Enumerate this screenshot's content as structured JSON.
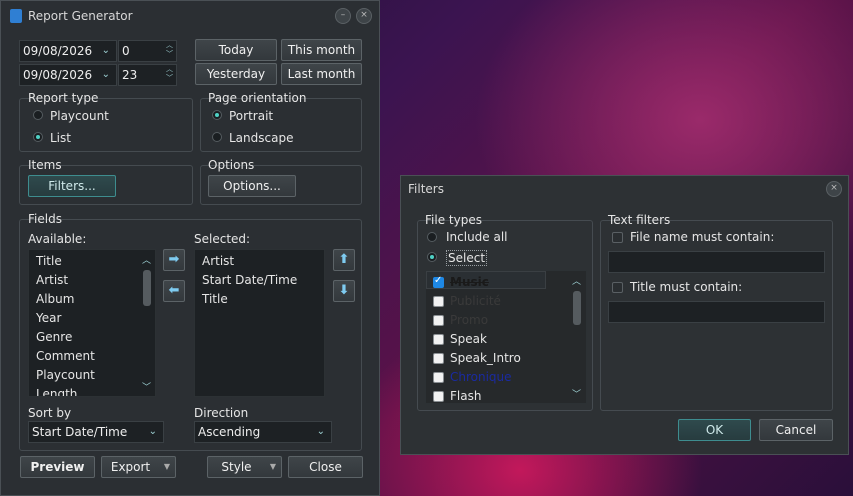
{
  "report_window": {
    "title": "Report Generator",
    "date_from": "09/08/2026",
    "hour_from": "0",
    "date_to": "09/08/2026",
    "hour_to": "23",
    "today_label": "Today",
    "this_month_label": "This month",
    "yesterday_label": "Yesterday",
    "last_month_label": "Last month",
    "report_type": {
      "label": "Report type",
      "options": [
        "Playcount",
        "List"
      ],
      "selected": "List"
    },
    "page_orientation": {
      "label": "Page orientation",
      "options": [
        "Portrait",
        "Landscape"
      ],
      "selected": "Portrait"
    },
    "items": {
      "label": "Items",
      "filters_button": "Filters..."
    },
    "options": {
      "label": "Options",
      "options_button": "Options..."
    },
    "fields": {
      "label": "Fields",
      "available_label": "Available:",
      "available": [
        "Title",
        "Artist",
        "Album",
        "Year",
        "Genre",
        "Comment",
        "Playcount",
        "Length"
      ],
      "selected_label": "Selected:",
      "selected": [
        "Artist",
        "Start Date/Time",
        "Title"
      ]
    },
    "sort_by": {
      "label": "Sort by",
      "value": "Start Date/Time"
    },
    "direction": {
      "label": "Direction",
      "value": "Ascending"
    },
    "footer": {
      "preview": "Preview",
      "export": "Export",
      "style": "Style",
      "close": "Close"
    }
  },
  "filters_window": {
    "title": "Filters",
    "file_types": {
      "label": "File types",
      "include_all": "Include all",
      "select": "Select",
      "selected": "Select",
      "items": [
        {
          "name": "Music",
          "checked": true,
          "style": "strike",
          "color": "#1a1a1a"
        },
        {
          "name": "Publicité",
          "checked": false,
          "style": "normal",
          "color": "#3a3a3a"
        },
        {
          "name": "Promo",
          "checked": false,
          "style": "normal",
          "color": "#3a3a3a"
        },
        {
          "name": "Speak",
          "checked": false,
          "style": "normal",
          "color": "#e6e6e6"
        },
        {
          "name": "Speak_Intro",
          "checked": false,
          "style": "normal",
          "color": "#e6e6e6"
        },
        {
          "name": "Chronique",
          "checked": false,
          "style": "normal",
          "color": "#1a2aa0"
        },
        {
          "name": "Flash",
          "checked": false,
          "style": "normal",
          "color": "#e6e6e6"
        }
      ]
    },
    "text_filters": {
      "label": "Text filters",
      "file_name_label": "File name must contain:",
      "file_name_value": "",
      "title_label": "Title must contain:",
      "title_value": ""
    },
    "ok": "OK",
    "cancel": "Cancel"
  },
  "colors": {
    "accent": "#4fd1c5",
    "window_bg": "#2b2f33",
    "field_bg": "#1d2124",
    "check": "#1e88e5"
  }
}
